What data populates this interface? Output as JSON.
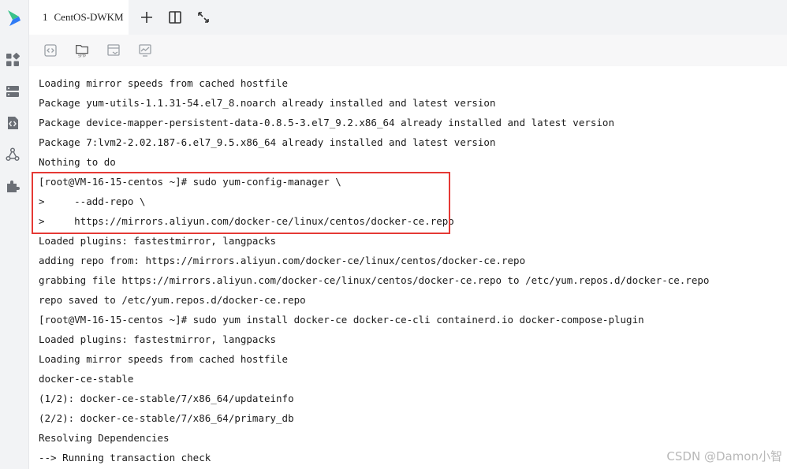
{
  "tab": {
    "index": "1",
    "title": "CentOS-DWKM"
  },
  "toolbar": {
    "sftp_label": "SFTP"
  },
  "terminal": {
    "lines": [
      "Loading mirror speeds from cached hostfile",
      "Package yum-utils-1.1.31-54.el7_8.noarch already installed and latest version",
      "Package device-mapper-persistent-data-0.8.5-3.el7_9.2.x86_64 already installed and latest version",
      "Package 7:lvm2-2.02.187-6.el7_9.5.x86_64 already installed and latest version",
      "Nothing to do",
      "[root@VM-16-15-centos ~]# sudo yum-config-manager \\",
      ">     --add-repo \\",
      ">     https://mirrors.aliyun.com/docker-ce/linux/centos/docker-ce.repo",
      "Loaded plugins: fastestmirror, langpacks",
      "adding repo from: https://mirrors.aliyun.com/docker-ce/linux/centos/docker-ce.repo",
      "grabbing file https://mirrors.aliyun.com/docker-ce/linux/centos/docker-ce.repo to /etc/yum.repos.d/docker-ce.repo",
      "repo saved to /etc/yum.repos.d/docker-ce.repo",
      "[root@VM-16-15-centos ~]# sudo yum install docker-ce docker-ce-cli containerd.io docker-compose-plugin",
      "Loaded plugins: fastestmirror, langpacks",
      "Loading mirror speeds from cached hostfile",
      "docker-ce-stable",
      "(1/2): docker-ce-stable/7/x86_64/updateinfo",
      "(2/2): docker-ce-stable/7/x86_64/primary_db",
      "Resolving Dependencies",
      "--> Running transaction check"
    ]
  },
  "watermark": "CSDN @Damon小智",
  "colors": {
    "highlight_border": "#e53935",
    "logo_blue": "#2f7bf5",
    "logo_green": "#3ac28a"
  },
  "icons": {
    "sidebar": [
      "dashboard-icon",
      "server-icon",
      "code-file-icon",
      "network-icon",
      "plugin-icon"
    ],
    "tabbar": [
      "plus-icon",
      "split-view-icon",
      "expand-icon"
    ],
    "toolbar": [
      "code-snippet-icon",
      "sftp-folder-icon",
      "file-transfer-icon",
      "monitor-icon"
    ]
  }
}
